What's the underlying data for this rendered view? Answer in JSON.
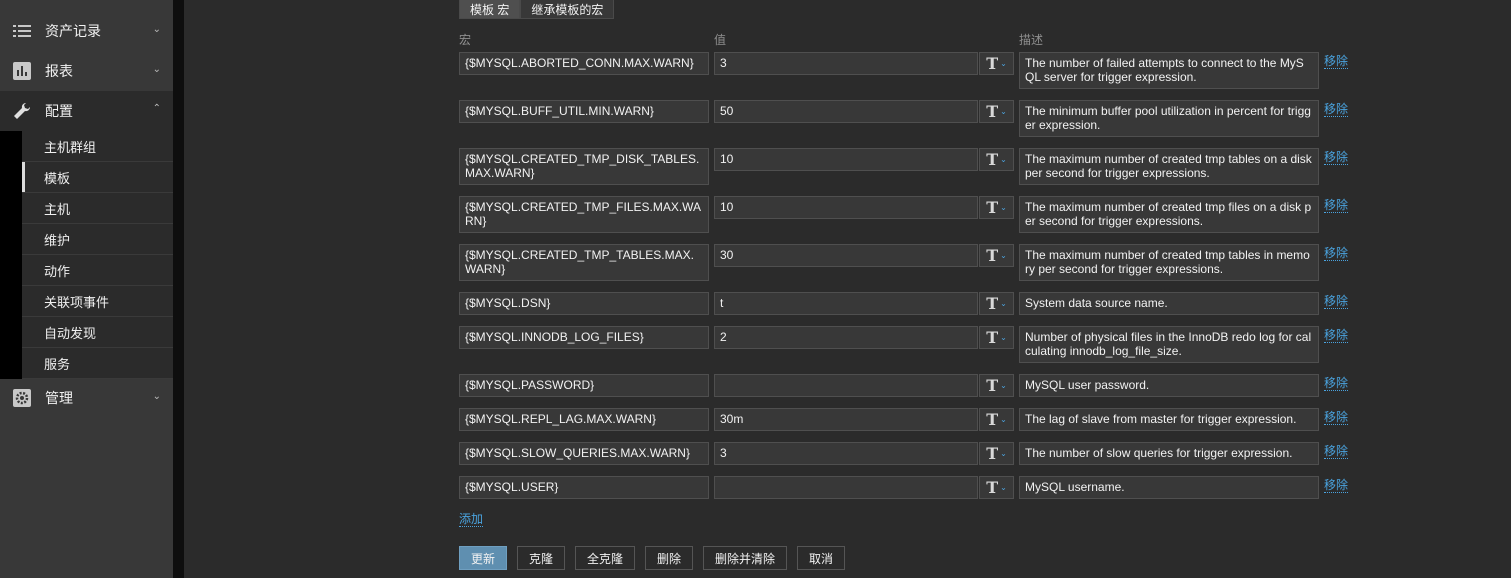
{
  "sidebar": {
    "sections": [
      {
        "label": "资产记录",
        "icon": "list-icon"
      },
      {
        "label": "报表",
        "icon": "bar-chart-icon"
      },
      {
        "label": "配置",
        "icon": "wrench-icon"
      },
      {
        "label": "管理",
        "icon": "gear-icon"
      }
    ],
    "config_items": [
      "主机群组",
      "模板",
      "主机",
      "维护",
      "动作",
      "关联项事件",
      "自动发现",
      "服务"
    ]
  },
  "tabs": [
    "模板 宏",
    "继承模板的宏"
  ],
  "columns": {
    "macro": "宏",
    "value": "值",
    "description": "描述"
  },
  "macros": [
    {
      "macro": "{$MYSQL.ABORTED_CONN.MAX.WARN}",
      "value": "3",
      "type": "T",
      "description": "The number of failed attempts to connect to the MySQL server for trigger expression.",
      "remove": "移除"
    },
    {
      "macro": "{$MYSQL.BUFF_UTIL.MIN.WARN}",
      "value": "50",
      "type": "T",
      "description": "The minimum buffer pool utilization in percent for trigger expression.",
      "remove": "移除"
    },
    {
      "macro": "{$MYSQL.CREATED_TMP_DISK_TABLES.MAX.WARN}",
      "value": "10",
      "type": "T",
      "description": "The maximum number of created tmp tables on a disk per second for trigger expressions.",
      "remove": "移除"
    },
    {
      "macro": "{$MYSQL.CREATED_TMP_FILES.MAX.WARN}",
      "value": "10",
      "type": "T",
      "description": "The maximum number of created tmp files on a disk per second for trigger expressions.",
      "remove": "移除"
    },
    {
      "macro": "{$MYSQL.CREATED_TMP_TABLES.MAX.WARN}",
      "value": "30",
      "type": "T",
      "description": "The maximum number of created tmp tables in memory per second for trigger expressions.",
      "remove": "移除"
    },
    {
      "macro": "{$MYSQL.DSN}",
      "value": "t",
      "type": "T",
      "description": "System data source name.",
      "remove": "移除"
    },
    {
      "macro": "{$MYSQL.INNODB_LOG_FILES}",
      "value": "2",
      "type": "T",
      "description": "Number of physical files in the InnoDB redo log for calculating innodb_log_file_size.",
      "remove": "移除"
    },
    {
      "macro": "{$MYSQL.PASSWORD}",
      "value": "",
      "type": "T",
      "description": "MySQL user password.",
      "remove": "移除"
    },
    {
      "macro": "{$MYSQL.REPL_LAG.MAX.WARN}",
      "value": "30m",
      "type": "T",
      "description": "The lag of slave from master for trigger expression.",
      "remove": "移除"
    },
    {
      "macro": "{$MYSQL.SLOW_QUERIES.MAX.WARN}",
      "value": "3",
      "type": "T",
      "description": "The number of slow queries for trigger expression.",
      "remove": "移除"
    },
    {
      "macro": "{$MYSQL.USER}",
      "value": "",
      "type": "T",
      "description": "MySQL username.",
      "remove": "移除"
    }
  ],
  "add_label": "添加",
  "buttons": [
    "更新",
    "克隆",
    "全克隆",
    "删除",
    "删除并清除",
    "取消"
  ],
  "colors": {
    "accent": "#4aa3df",
    "primary_button": "#5f8fb0",
    "background": "#2b2b2b",
    "sidebar": "#383838"
  }
}
